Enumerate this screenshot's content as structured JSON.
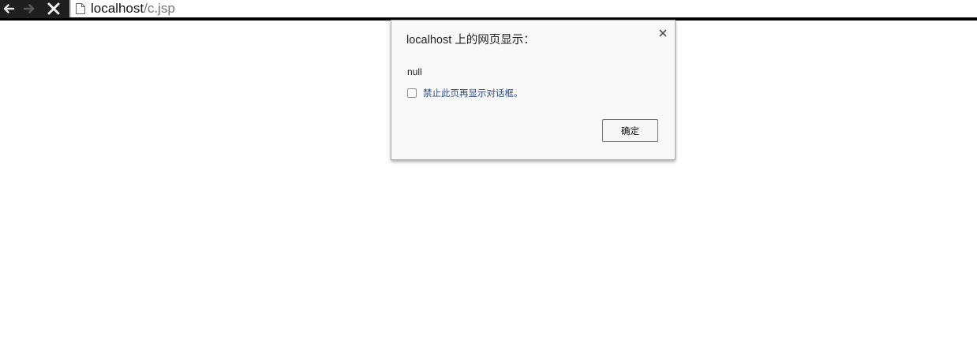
{
  "browser": {
    "url_host": "localhost",
    "url_path": "/c.jsp",
    "nav_icons": [
      "back-arrow-icon",
      "forward-arrow-icon",
      "stop-icon",
      "page-icon"
    ]
  },
  "dialog": {
    "title": "localhost 上的网页显示：",
    "message": "null",
    "suppress_label": "禁止此页再显示对话框。",
    "suppress_checked": false,
    "ok_label": "确定",
    "close_icon": "close-icon"
  },
  "colors": {
    "toolbar": "#1f1f1f",
    "dialog_bg": "#f8f8f8",
    "link_blue": "#2b4a88",
    "button_border": "#4d7ab8"
  }
}
